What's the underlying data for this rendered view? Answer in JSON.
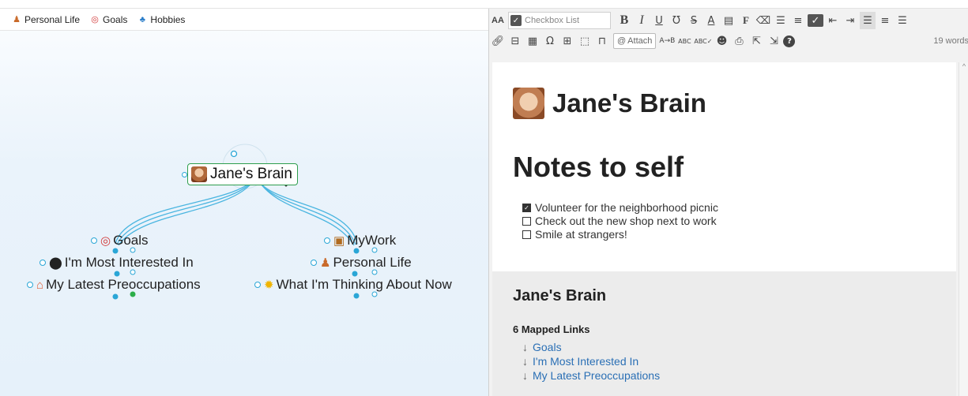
{
  "pins": [
    {
      "icon": "person-icon",
      "glyph": "♟",
      "label": "Personal Life"
    },
    {
      "icon": "target-icon",
      "glyph": "◎",
      "label": "Goals"
    },
    {
      "icon": "hobbies-icon",
      "glyph": "♣",
      "label": "Hobbies"
    }
  ],
  "map": {
    "central": "Jane's Brain",
    "left": [
      "Goals",
      "I'm Most Interested In",
      "My Latest Preoccupations"
    ],
    "right": [
      "MyWork",
      "Personal Life",
      "What I'm Thinking About Now"
    ]
  },
  "toolbar": {
    "font_size_label": "AA",
    "style_combo": "Checkbox List",
    "attach_label": "Attach",
    "word_count": "19 words"
  },
  "doc": {
    "title": "Jane's Brain",
    "heading": "Notes to self",
    "checklist": [
      {
        "checked": true,
        "text": "Volunteer for the neighborhood picnic"
      },
      {
        "checked": false,
        "text": "Check out the new shop next to work"
      },
      {
        "checked": false,
        "text": "Smile at strangers!"
      }
    ],
    "mapped_title": "Jane's Brain",
    "mapped_count": "6 Mapped Links",
    "mapped_links": [
      "Goals",
      "I'm Most Interested In",
      "My Latest Preoccupations"
    ]
  },
  "colors": {
    "link_line": "#4ab5e0",
    "central_border": "#2e9e4e",
    "doc_link": "#2a6fb5"
  }
}
